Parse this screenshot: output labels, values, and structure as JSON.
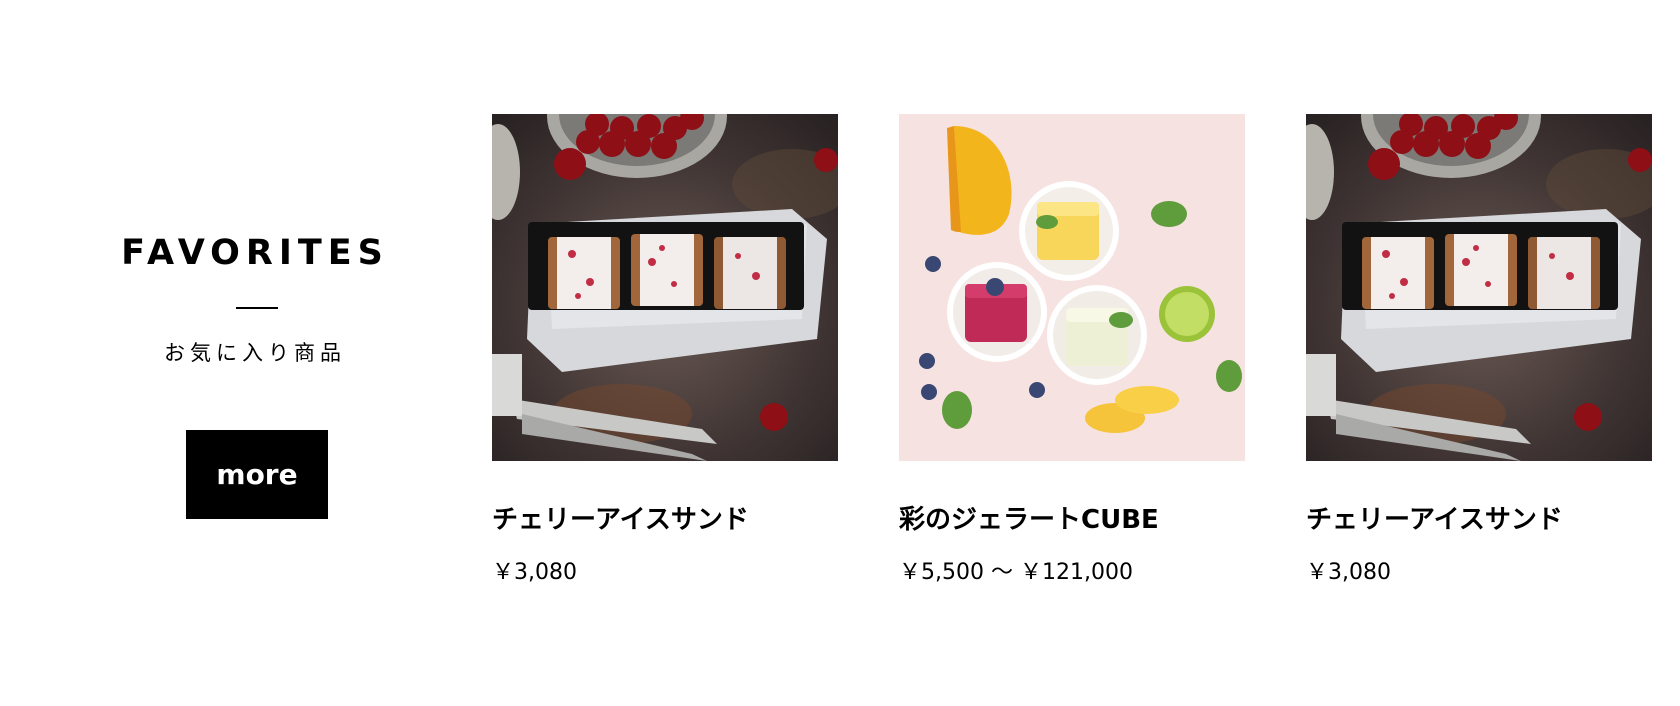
{
  "favorites": {
    "title": "FAVORITES",
    "subtitle": "お気に入り商品",
    "more_label": "more"
  },
  "products": [
    {
      "name": "チェリーアイスサンド",
      "price": "￥3,080",
      "image": "cherry-ice-sandwich-photo"
    },
    {
      "name": "彩のジェラートCUBE",
      "price": "￥5,500 〜 ￥121,000",
      "image": "gelato-cube-photo"
    },
    {
      "name": "チェリーアイスサンド",
      "price": "￥3,080",
      "image": "cherry-ice-sandwich-photo"
    }
  ]
}
